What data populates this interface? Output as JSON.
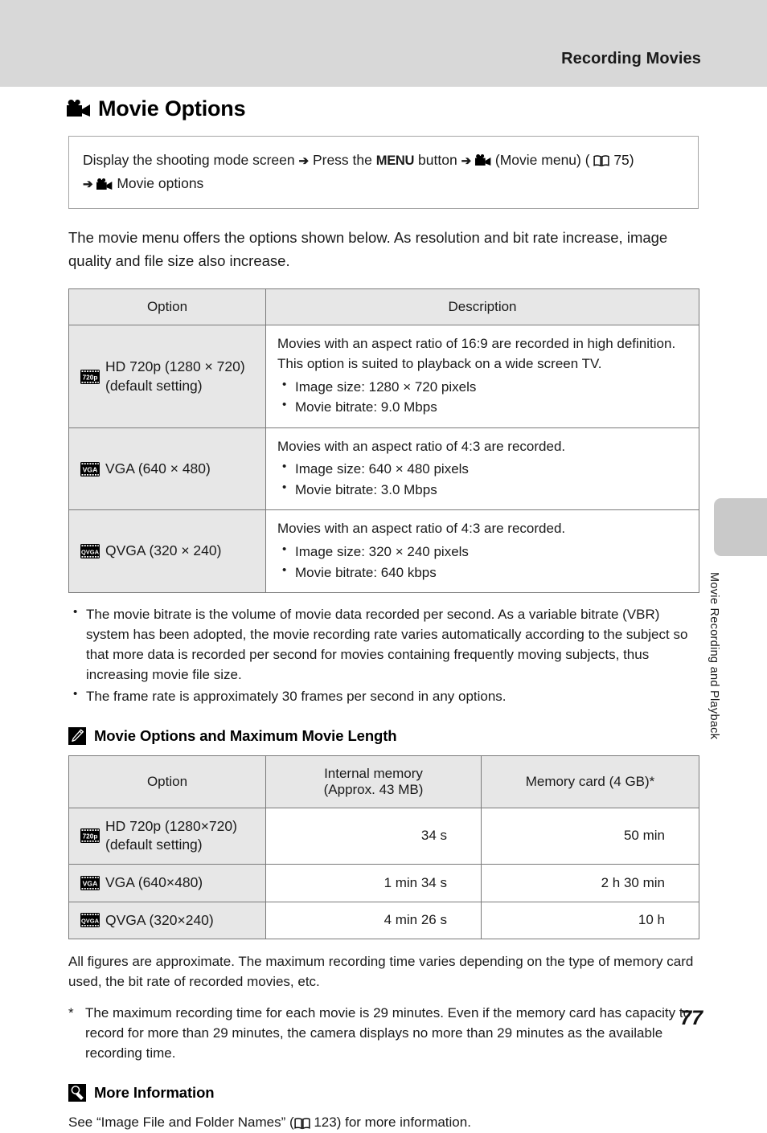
{
  "header": {
    "title": "Recording Movies",
    "band_color": "#d8d8d8"
  },
  "side_tab": {
    "label": "Movie Recording and Playback",
    "tab_color": "#c9c9c9"
  },
  "page": {
    "number": "77",
    "heading": "Movie Options",
    "heading_icon": "movie-camera-icon"
  },
  "nav_box": {
    "part1": "Display the shooting mode screen",
    "arrow": "➔",
    "part2": "Press the",
    "menu_word": "MENU",
    "part3": "button",
    "part4": "(Movie menu) (",
    "page_ref_icon": "book-icon",
    "page_ref": "75",
    "part5": ")",
    "part6": "Movie options"
  },
  "intro": "The movie menu offers the options shown below. As resolution and bit rate increase, image quality and file size also increase.",
  "options_table": {
    "headers": [
      "Option",
      "Description"
    ],
    "rows": [
      {
        "icon": "720p-badge-icon",
        "icon_label": "720p",
        "option": "HD 720p (1280 × 720) (default setting)",
        "desc_intro": "Movies with an aspect ratio of 16:9 are recorded in high definition. This option is suited to playback on a wide screen TV.",
        "desc_bullets": [
          "Image size: 1280 × 720 pixels",
          "Movie bitrate: 9.0 Mbps"
        ]
      },
      {
        "icon": "vga-badge-icon",
        "icon_label": "VGA",
        "option": "VGA (640 × 480)",
        "desc_intro": "Movies with an aspect ratio of 4:3 are recorded.",
        "desc_bullets": [
          "Image size: 640 × 480 pixels",
          "Movie bitrate: 3.0 Mbps"
        ]
      },
      {
        "icon": "qvga-badge-icon",
        "icon_label": "QVGA",
        "option": "QVGA (320 × 240)",
        "desc_intro": "Movies with an aspect ratio of 4:3 are recorded.",
        "desc_bullets": [
          "Image size: 320 × 240 pixels",
          "Movie bitrate: 640 kbps"
        ]
      }
    ]
  },
  "notes": [
    "The movie bitrate is the volume of movie data recorded per second. As a variable bitrate (VBR) system has been adopted, the movie recording rate varies automatically according to the subject so that more data is recorded per second for movies containing frequently moving subjects, thus increasing movie file size.",
    "The frame rate is approximately 30 frames per second in any options."
  ],
  "length_section": {
    "icon": "pencil-note-icon",
    "heading": "Movie Options and Maximum Movie Length",
    "headers": [
      "Option",
      "Internal memory\n(Approx. 43 MB)",
      "Memory card (4 GB)*"
    ],
    "header_internal_line1": "Internal memory",
    "header_internal_line2": "(Approx. 43 MB)",
    "rows": [
      {
        "icon": "720p-badge-icon",
        "icon_label": "720p",
        "option": "HD 720p (1280×720) (default setting)",
        "internal": "34 s",
        "card": "50 min"
      },
      {
        "icon": "vga-badge-icon",
        "icon_label": "VGA",
        "option": "VGA (640×480)",
        "internal": "1 min 34 s",
        "card": "2 h 30 min"
      },
      {
        "icon": "qvga-badge-icon",
        "icon_label": "QVGA",
        "option": "QVGA (320×240)",
        "internal": "4 min 26 s",
        "card": "10 h"
      }
    ],
    "footnote_general": "All figures are approximate. The maximum recording time varies depending on the type of memory card used, the bit rate of recorded movies, etc.",
    "footnote_star_marker": "*",
    "footnote_star": "The maximum recording time for each movie is 29 minutes. Even if the memory card has capacity to record for more than 29 minutes, the camera displays no more than 29 minutes as the available recording time."
  },
  "more_info": {
    "icon": "magnifier-note-icon",
    "heading": "More Information",
    "text_before": "See “Image File and Folder Names” (",
    "page_ref_icon": "book-icon",
    "page_ref": "123",
    "text_after": ") for more information."
  }
}
